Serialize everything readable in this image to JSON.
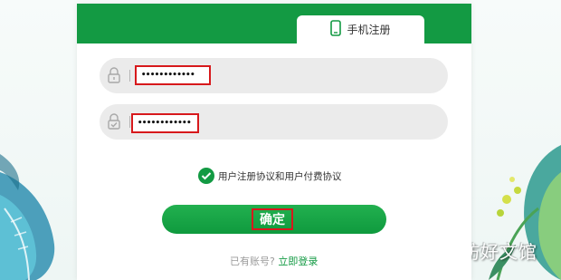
{
  "tabs": {
    "phone_register": "手机注册"
  },
  "form": {
    "field1_value": "••••••••••••",
    "field2_value": "••••••••••••"
  },
  "agreement": {
    "text": "用户注册协议和用户付费协议"
  },
  "confirm_button": {
    "label": "确定"
  },
  "login": {
    "hint": "已有账号?",
    "link": "立即登录"
  },
  "watermark": {
    "text": "易坊好文馆"
  },
  "colors": {
    "brand_green": "#139a43",
    "highlight_red": "#d7191c",
    "field_bg": "#ebebeb"
  }
}
